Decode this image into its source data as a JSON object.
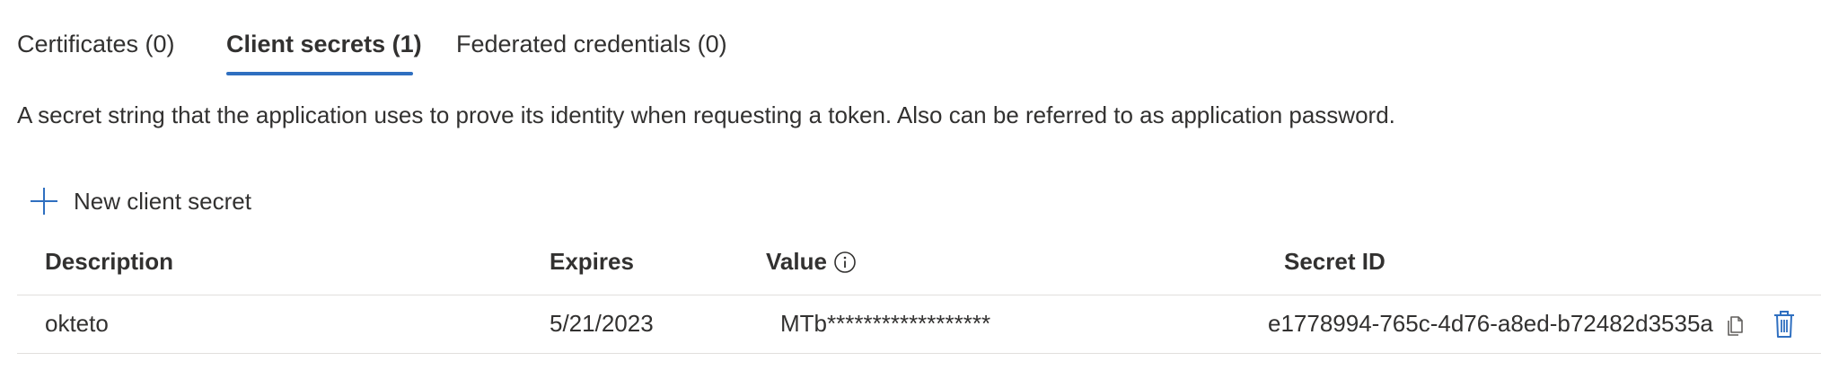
{
  "tabs": [
    {
      "label": "Certificates (0)",
      "active": false
    },
    {
      "label": "Client secrets (1)",
      "active": true
    },
    {
      "label": "Federated credentials (0)",
      "active": false
    }
  ],
  "description": "A secret string that the application uses to prove its identity when requesting a token. Also can be referred to as application password.",
  "toolbar": {
    "new_secret_label": "New client secret",
    "icon": "plus-icon"
  },
  "table": {
    "columns": [
      "Description",
      "Expires",
      "Value",
      "Secret ID"
    ],
    "value_info_icon": "info-icon",
    "rows": [
      {
        "description": "okteto",
        "expires": "5/21/2023",
        "value": "MTb******************",
        "secret_id": "e1778994-765c-4d76-a8ed-b72482d3535a",
        "actions": [
          "copy-icon",
          "delete-icon"
        ]
      }
    ]
  },
  "colors": {
    "accent": "#2f6fc0",
    "text": "#323130",
    "divider": "#e1dfdd"
  }
}
